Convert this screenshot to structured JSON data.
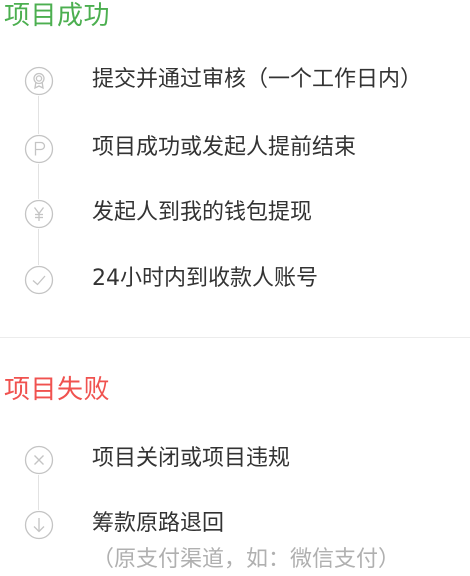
{
  "success": {
    "title": "项目成功",
    "color": "#4caf50",
    "steps": [
      {
        "icon": "award-medal-icon",
        "text": "提交并通过审核（一个工作日内）"
      },
      {
        "icon": "parking-p-icon",
        "text": "项目成功或发起人提前结束"
      },
      {
        "icon": "yen-icon",
        "text": "发起人到我的钱包提现"
      },
      {
        "icon": "checkmark-icon",
        "text": "24小时内到收款人账号"
      }
    ]
  },
  "failure": {
    "title": "项目失败",
    "color": "#f0524f",
    "steps": [
      {
        "icon": "close-x-icon",
        "text": "项目关闭或项目违规"
      },
      {
        "icon": "arrow-down-icon",
        "text": "筹款原路退回",
        "note": "（原支付渠道，如：微信支付）"
      }
    ]
  },
  "colors": {
    "icon_stroke": "#c4c4c4",
    "text": "#333333",
    "note": "#b0b0b0",
    "line": "#e2e2e2"
  }
}
